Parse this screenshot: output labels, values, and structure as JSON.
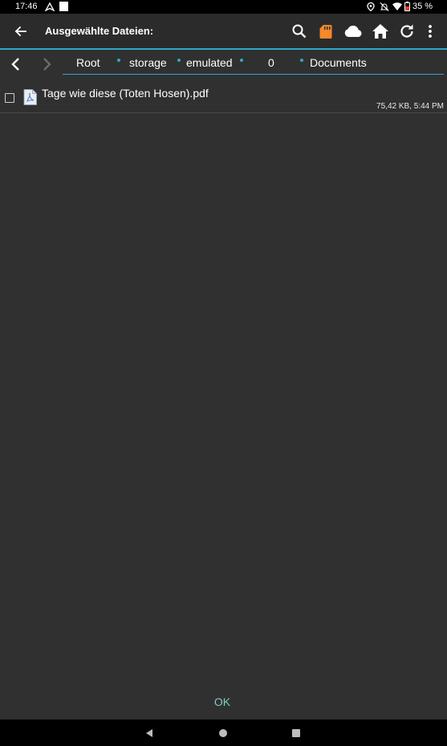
{
  "status_bar": {
    "time": "17:46",
    "battery": "35 %",
    "icons": [
      "navigation-arrow-icon",
      "white-square-icon",
      "location-icon",
      "mute-icon",
      "wifi-icon",
      "battery-icon"
    ]
  },
  "toolbar": {
    "title": "Ausgewählte Dateien:",
    "icons": [
      "back-arrow-icon",
      "search-icon",
      "sd-card-icon",
      "cloud-icon",
      "home-icon",
      "refresh-icon",
      "more-vert-icon"
    ],
    "accent_color": "#30a7c8",
    "sd_card_color": "#f5882a"
  },
  "path_bar": {
    "crumbs": [
      "Root",
      "storage",
      "emulated",
      "0",
      "Documents"
    ]
  },
  "files": [
    {
      "name": "Tage wie diese (Toten Hosen).pdf",
      "meta": "75,42 KB, 5:44 PM",
      "icon": "pdf-file-icon"
    }
  ],
  "footer": {
    "ok_label": "OK",
    "ok_color": "#80cbc4"
  },
  "nav_bar": {
    "icons": [
      "nav-back-icon",
      "nav-home-icon",
      "nav-recents-icon"
    ]
  }
}
